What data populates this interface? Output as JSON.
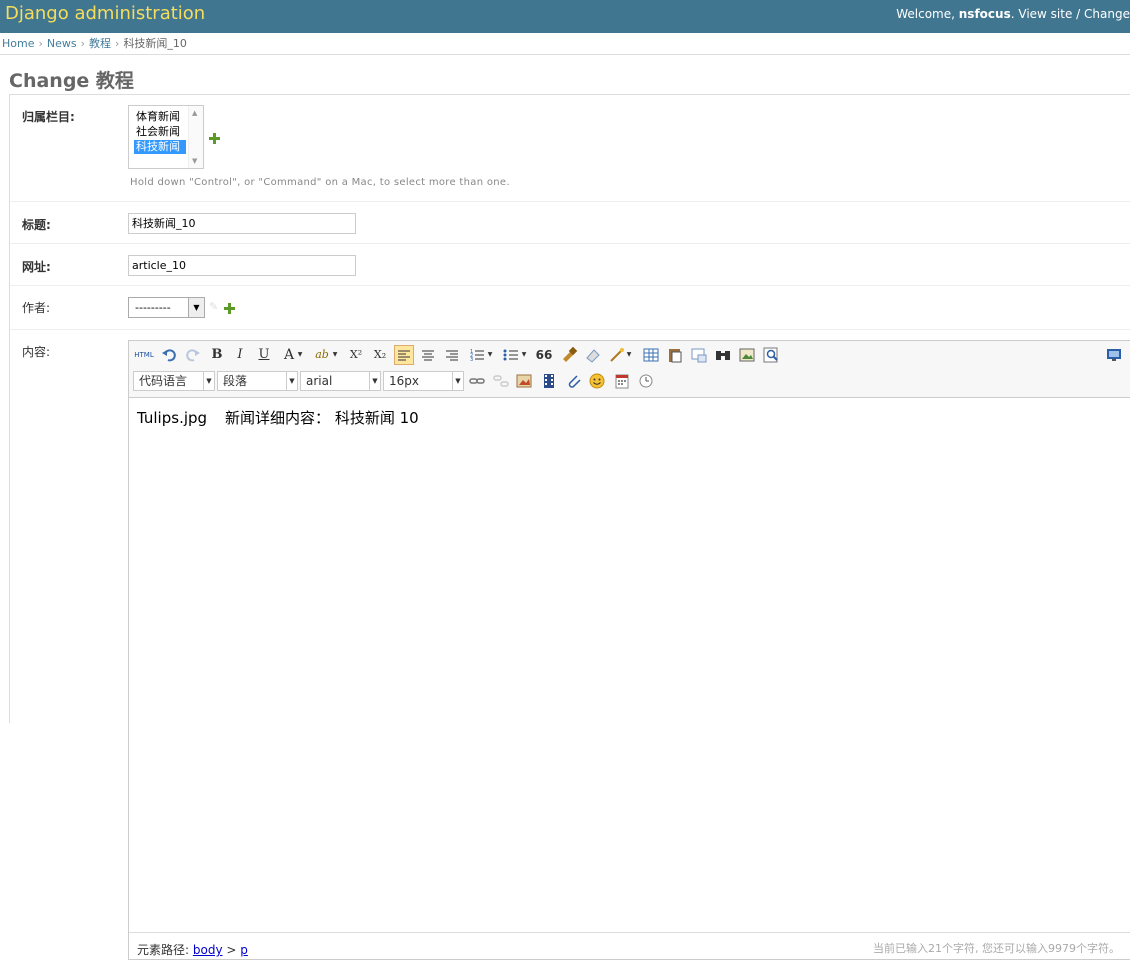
{
  "header": {
    "site_name": "Django administration",
    "welcome_prefix": "Welcome,",
    "username": "nsfocus",
    "welcome_suffix": ".",
    "view_site": "View site",
    "separator": "/",
    "change_password": "Change"
  },
  "breadcrumbs": {
    "home": "Home",
    "app": "News",
    "model": "教程",
    "current": "科技新闻_10",
    "sep": "›"
  },
  "page_title": "Change 教程",
  "form": {
    "column": {
      "label": "归属栏目:",
      "options": [
        "体育新闻",
        "社会新闻",
        "科技新闻"
      ],
      "selected": "科技新闻",
      "help": "Hold down \"Control\", or \"Command\" on a Mac, to select more than one."
    },
    "title": {
      "label": "标题:",
      "value": "科技新闻_10"
    },
    "url": {
      "label": "网址:",
      "value": "article_10"
    },
    "author": {
      "label": "作者:",
      "value": "---------"
    },
    "content": {
      "label": "内容:"
    }
  },
  "editor": {
    "toolbar_row1": [
      "html-icon",
      "undo-icon",
      "redo-icon",
      "bold-icon",
      "italic-icon",
      "underline-icon",
      "font-color-icon",
      "highlight-icon",
      "superscript-icon",
      "subscript-icon",
      "align-left-icon",
      "align-center-icon",
      "align-right-icon",
      "ordered-list-icon",
      "unordered-list-icon",
      "blockquote-icon",
      "format-painter-icon",
      "eraser-icon",
      "auto-format-icon",
      "table-icon",
      "paste-icon",
      "word-image-icon",
      "search-icon",
      "image-icon",
      "preview-icon",
      "fullscreen-icon"
    ],
    "toolbar_labels": {
      "html": "HTML",
      "bold": "B",
      "italic": "I",
      "underline": "U",
      "font_color": "A",
      "highlight": "ab",
      "superscript": "X²",
      "subscript": "X₂",
      "blockquote": "66"
    },
    "combos": {
      "code_lang": "代码语言",
      "paragraph": "段落",
      "font_family": "arial",
      "font_size": "16px"
    },
    "body_file": "Tulips.jpg",
    "body_text": "新闻详细内容： 科技新闻 10",
    "path_label": "元素路径:",
    "path_body": "body",
    "path_sep": ">",
    "path_p": "p",
    "counter": "当前已输入21个字符, 您还可以输入9979个字符。"
  },
  "colors": {
    "header_bg": "#417690",
    "site_name": "#f5dd5d",
    "link": "#447e9b",
    "add_icon": "#5b9a28",
    "selected_option": "#3399ff"
  }
}
